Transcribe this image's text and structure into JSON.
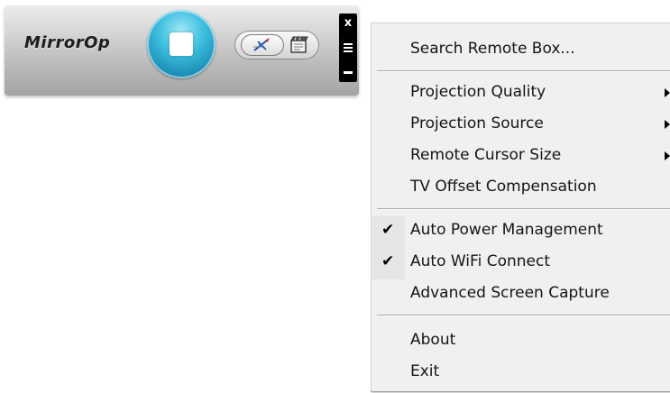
{
  "toolbar": {
    "logo_text": "MirrorOp",
    "stop_button_icon": "stop-square-icon",
    "mode_toggle": {
      "left_icon": "compass-icon",
      "right_icon": "film-icon"
    },
    "window_controls": {
      "close_label": "x",
      "menu_icon": "menu-icon",
      "minimize_icon": "minimize-icon"
    },
    "colors": {
      "stop_button_accent": "#3fbfe0",
      "window_controls_bg": "#000000"
    }
  },
  "context_menu": {
    "items": [
      {
        "label": "Search Remote Box...",
        "checked": false,
        "has_submenu": false
      },
      {
        "label": "Projection Quality",
        "checked": false,
        "has_submenu": true
      },
      {
        "label": "Projection Source",
        "checked": false,
        "has_submenu": true
      },
      {
        "label": "Remote Cursor Size",
        "checked": false,
        "has_submenu": true
      },
      {
        "label": "TV Offset Compensation",
        "checked": false,
        "has_submenu": false
      },
      {
        "label": "Auto Power Management",
        "checked": true,
        "has_submenu": false
      },
      {
        "label": "Auto WiFi Connect",
        "checked": true,
        "has_submenu": false
      },
      {
        "label": "Advanced Screen Capture",
        "checked": false,
        "has_submenu": false
      },
      {
        "label": "About",
        "checked": false,
        "has_submenu": false
      },
      {
        "label": "Exit",
        "checked": false,
        "has_submenu": false
      }
    ],
    "check_mark": "✔"
  }
}
